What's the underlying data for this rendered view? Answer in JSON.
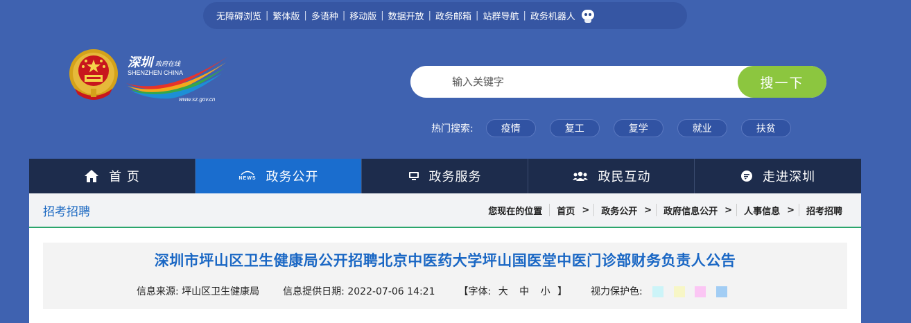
{
  "topbar": {
    "items": [
      "无障碍浏览",
      "繁体版",
      "多语种",
      "移动版",
      "数据开放",
      "政务邮箱",
      "站群导航",
      "政务机器人"
    ]
  },
  "logo": {
    "script_text": "深圳",
    "script_small": "政府在线",
    "en_text": "SHENZHEN CHINA",
    "url_text": "www.sz.gov.cn"
  },
  "search": {
    "placeholder": "输入关键字",
    "button_label": "搜一下"
  },
  "hot": {
    "label": "热门搜索:",
    "tags": [
      "疫情",
      "复工",
      "复学",
      "就业",
      "扶贫"
    ]
  },
  "nav": {
    "items": [
      {
        "label": "首 页",
        "icon": "home-icon"
      },
      {
        "label": "政务公开",
        "icon": "news-icon"
      },
      {
        "label": "政务服务",
        "icon": "monitor-icon"
      },
      {
        "label": "政民互动",
        "icon": "people-icon"
      },
      {
        "label": "走进深圳",
        "icon": "chat-icon"
      }
    ]
  },
  "section": {
    "title": "招考招聘"
  },
  "breadcrumb": {
    "prefix": "您现在的位置",
    "items": [
      "首页",
      "政务公开",
      "政府信息公开",
      "人事信息",
      "招考招聘"
    ]
  },
  "article": {
    "title": "深圳市坪山区卫生健康局公开招聘北京中医药大学坪山国医堂中医门诊部财务负责人公告",
    "source_label": "信息来源:",
    "source_value": "坪山区卫生健康局",
    "date_label": "信息提供日期:",
    "date_value": "2022-07-06 14:21",
    "font_label": "【字体:",
    "font_options": [
      "大",
      "中",
      "小"
    ],
    "font_close": "】",
    "eye_label": "视力保护色:",
    "eye_colors": [
      "#ccf4f8",
      "#f7f6c6",
      "#fbc6f4",
      "#a2cdf4"
    ]
  },
  "colors": {
    "page_bg": "#3f62b0",
    "nav_bg": "#1d2c4c",
    "nav_active": "#1a6dce",
    "search_btn": "#8cc63f",
    "title_blue": "#1a67c4"
  }
}
